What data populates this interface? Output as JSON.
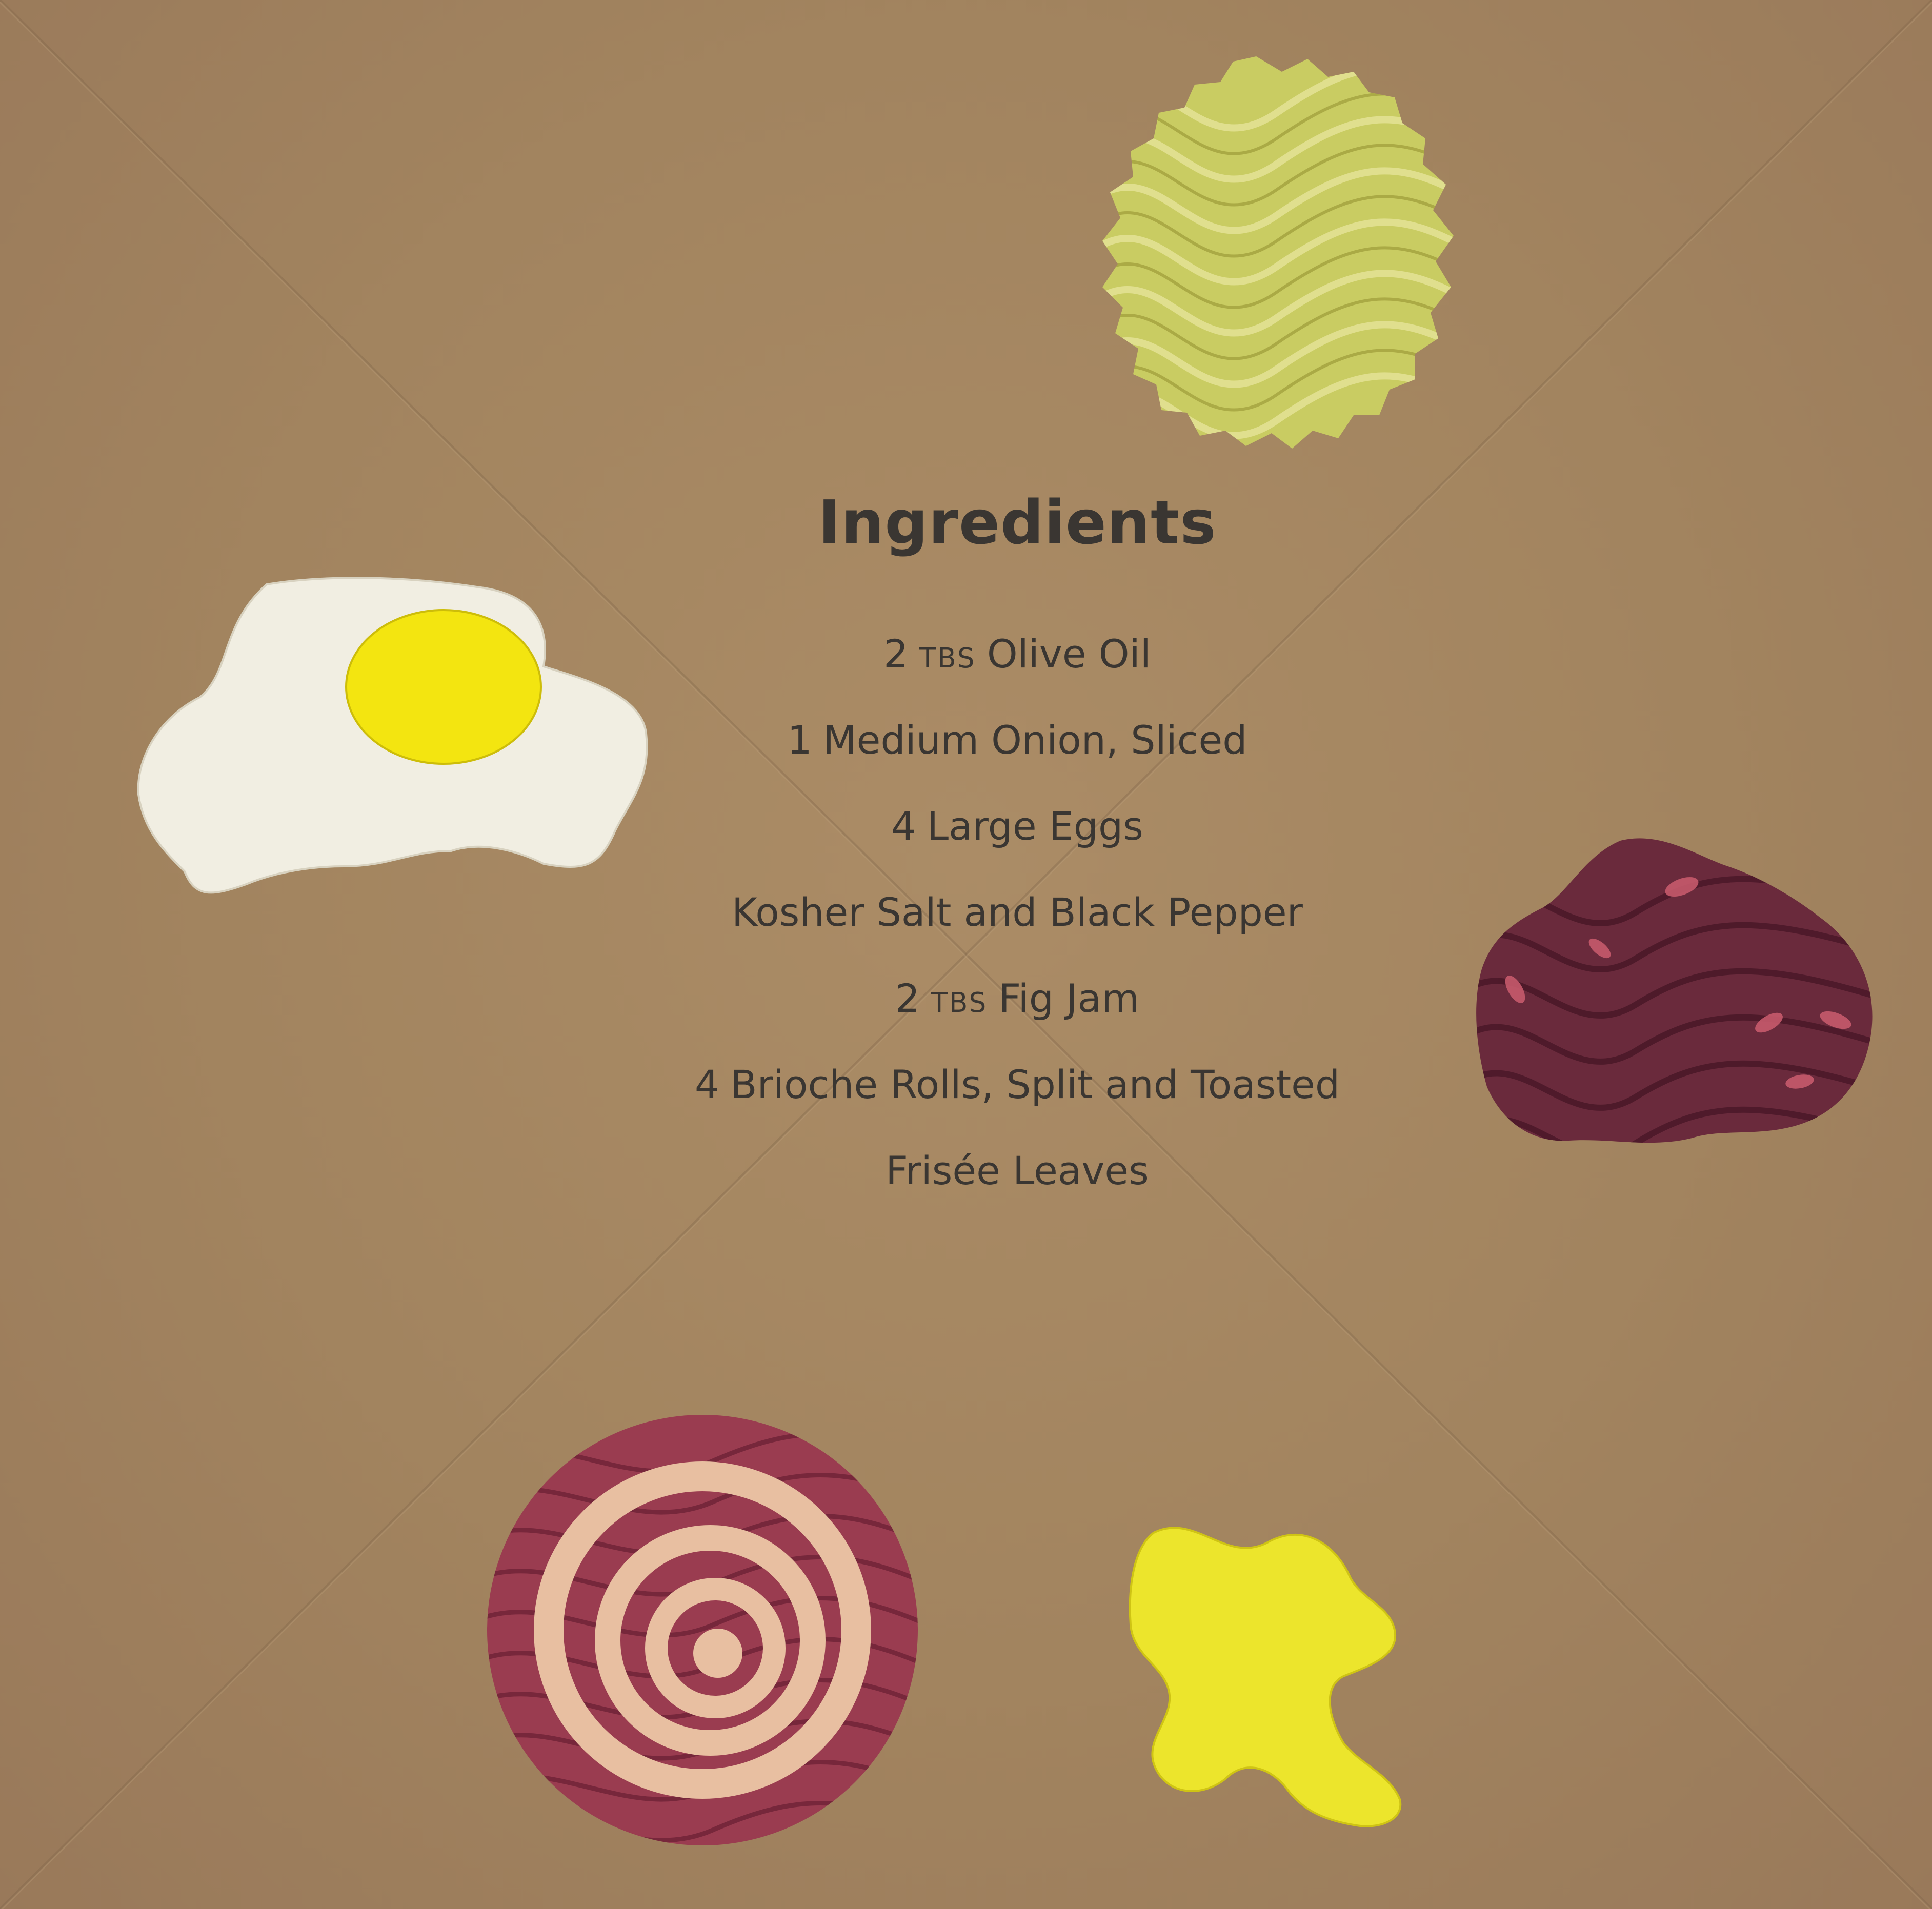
{
  "heading": "Ingredients",
  "ingredients": [
    {
      "qty": "2",
      "unit": "TBS",
      "item": "Olive Oil"
    },
    {
      "qty": "1",
      "unit": "",
      "item": "Medium Onion, Sliced"
    },
    {
      "qty": "4",
      "unit": "",
      "item": "Large Eggs"
    },
    {
      "qty": "",
      "unit": "",
      "item": "Kosher Salt and Black Pepper"
    },
    {
      "qty": "2",
      "unit": "TBS",
      "item": "Fig Jam"
    },
    {
      "qty": "4",
      "unit": "",
      "item": "Brioche Rolls, Split and Toasted"
    },
    {
      "qty": "",
      "unit": "",
      "item": "Frisée Leaves"
    }
  ],
  "cutouts": [
    {
      "name": "frisee-cutout-icon",
      "depicts": "frisee leaf",
      "color": "#c9cc62"
    },
    {
      "name": "fried-egg-cutout-icon",
      "depicts": "fried egg",
      "color": "#f1eee2",
      "yolk_color": "#f3e510"
    },
    {
      "name": "fig-jam-cutout-icon",
      "depicts": "fig jam",
      "color": "#6a2a3c"
    },
    {
      "name": "red-onion-cutout-icon",
      "depicts": "red onion slice",
      "color": "#9a3c50",
      "ring_color": "#e8bfa1"
    },
    {
      "name": "olive-oil-cutout-icon",
      "depicts": "olive oil splash",
      "color": "#ece52c"
    }
  ],
  "colors": {
    "paper": "#a38560",
    "ink": "#3a3632"
  }
}
